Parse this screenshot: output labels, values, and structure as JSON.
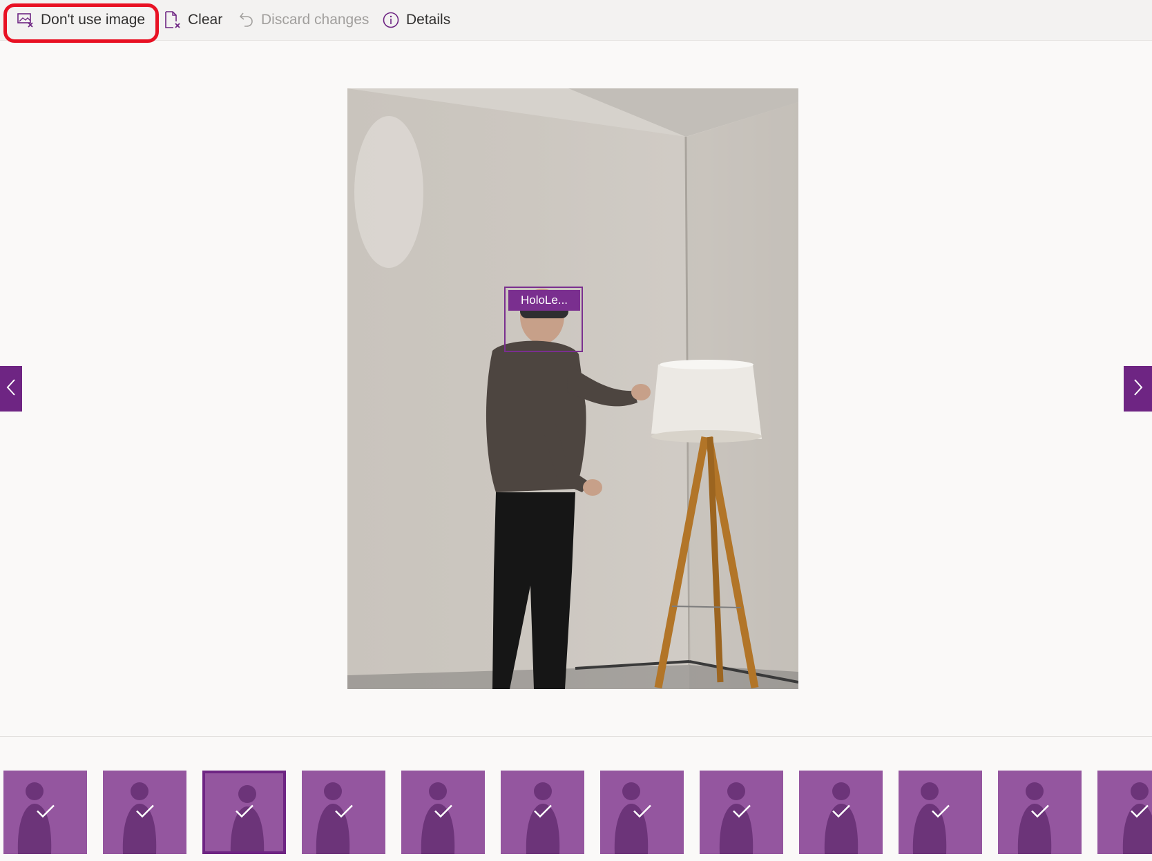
{
  "toolbar": {
    "dont_use_image_label": "Don't use image",
    "clear_label": "Clear",
    "discard_changes_label": "Discard changes",
    "details_label": "Details"
  },
  "image": {
    "bbox_tag_label": "HoloLe..."
  },
  "colors": {
    "accent": "#6e2583",
    "tag": "#7a2f8f",
    "highlight": "#e81123",
    "disabled_text": "#a19f9d"
  },
  "filmstrip": {
    "thumbnails": [
      {
        "checked": true,
        "selected": false
      },
      {
        "checked": true,
        "selected": false
      },
      {
        "checked": true,
        "selected": true
      },
      {
        "checked": true,
        "selected": false
      },
      {
        "checked": true,
        "selected": false
      },
      {
        "checked": true,
        "selected": false
      },
      {
        "checked": true,
        "selected": false
      },
      {
        "checked": true,
        "selected": false
      },
      {
        "checked": true,
        "selected": false
      },
      {
        "checked": true,
        "selected": false
      },
      {
        "checked": true,
        "selected": false
      },
      {
        "checked": true,
        "selected": false
      }
    ]
  },
  "icons": {
    "dont_use_image": "image-exclude-icon",
    "clear": "document-clear-icon",
    "discard_changes": "undo-icon",
    "details": "info-icon",
    "prev": "chevron-left-icon",
    "next": "chevron-right-icon",
    "tagged": "checkmark-icon"
  }
}
